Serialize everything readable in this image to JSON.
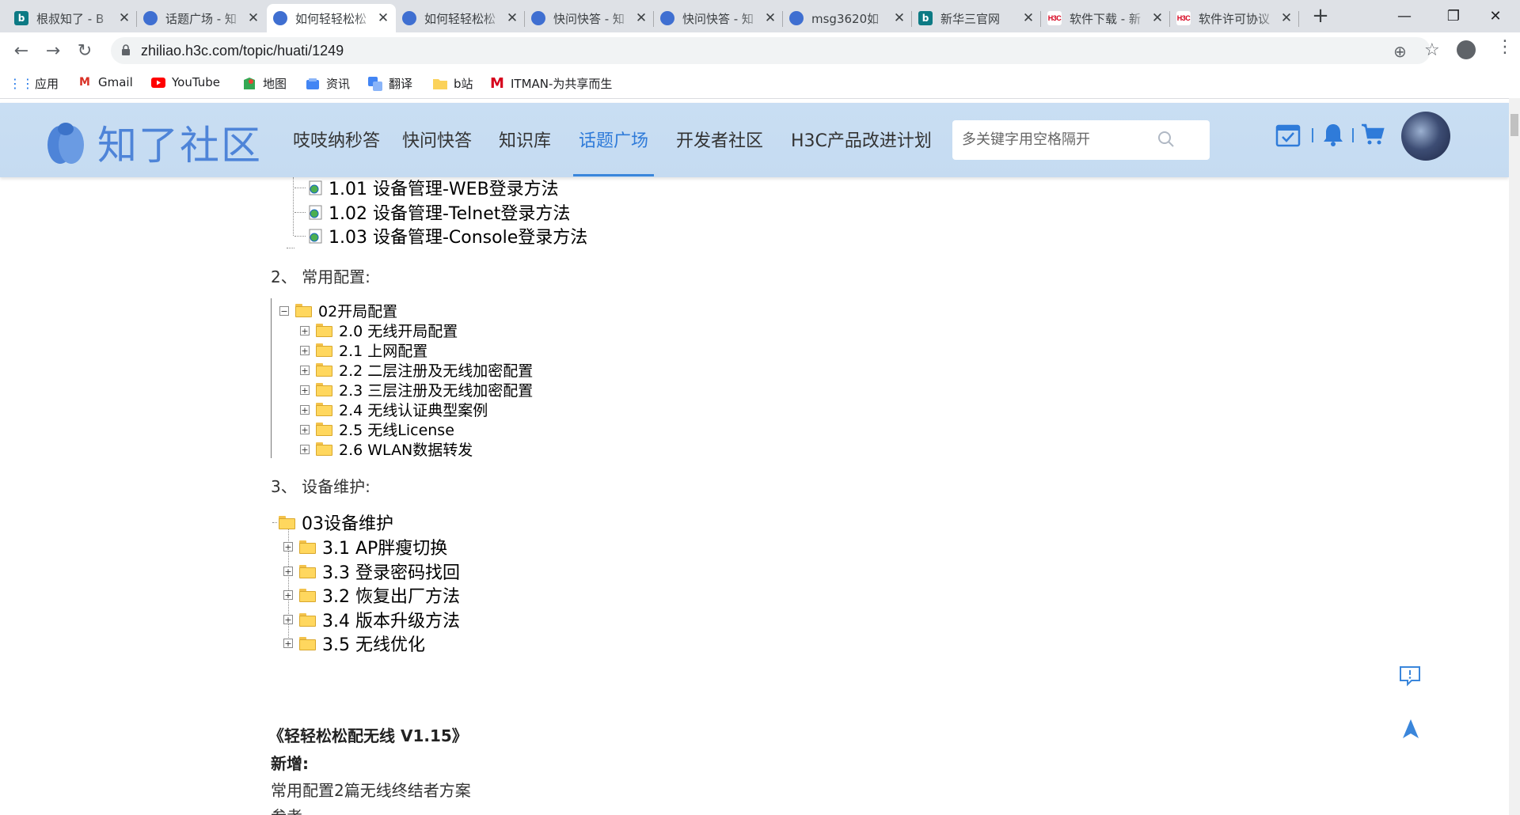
{
  "browser": {
    "tabs": [
      {
        "title": "根叔知了 - B",
        "icon": "bing"
      },
      {
        "title": "话题广场 - 知",
        "icon": "zhiliao"
      },
      {
        "title": "如何轻轻松松",
        "icon": "zhiliao"
      },
      {
        "title": "如何轻轻松松",
        "icon": "zhiliao"
      },
      {
        "title": "快问快答 - 知",
        "icon": "zhiliao"
      },
      {
        "title": "快问快答 - 知",
        "icon": "zhiliao"
      },
      {
        "title": "msg3620如",
        "icon": "zhiliao"
      },
      {
        "title": "新华三官网",
        "icon": "bing"
      },
      {
        "title": "软件下载 - 新",
        "icon": "h3c"
      },
      {
        "title": "软件许可协议",
        "icon": "h3c"
      }
    ],
    "active_tab": 2,
    "url": "zhiliao.h3c.com/topic/huati/1249",
    "h3c_icon_text": "H3C",
    "bing_icon_text": "b",
    "bookmarks": [
      {
        "label": "应用",
        "icon": "apps-grid-icon"
      },
      {
        "label": "Gmail",
        "icon": "gmail-icon"
      },
      {
        "label": "YouTube",
        "icon": "youtube-icon"
      },
      {
        "label": "地图",
        "icon": "maps-icon"
      },
      {
        "label": "资讯",
        "icon": "news-icon"
      },
      {
        "label": "翻译",
        "icon": "translate-icon"
      },
      {
        "label": "b站",
        "icon": "folder-icon"
      },
      {
        "label": "ITMAN-为共享而生",
        "icon": "itman-icon"
      }
    ]
  },
  "site": {
    "logo_text": "知了社区",
    "nav": [
      "吱吱纳秒答",
      "快问快答",
      "知识库",
      "话题广场",
      "开发者社区",
      "H3C产品改进计划"
    ],
    "active_nav": 3,
    "search_placeholder": "多关键字用空格隔开",
    "accent_color": "#3a86db"
  },
  "content": {
    "tree1_items": [
      "1.01 设备管理-WEB登录方法",
      "1.02 设备管理-Telnet登录方法",
      "1.03 设备管理-Console登录方法"
    ],
    "section2_heading": "2、  常用配置:",
    "tree2_root": "02开局配置",
    "tree2_items": [
      "2.0 无线开局配置",
      "2.1 上网配置",
      "2.2 二层注册及无线加密配置",
      "2.3 三层注册及无线加密配置",
      "2.4 无线认证典型案例",
      "2.5 无线License",
      "2.6 WLAN数据转发"
    ],
    "section3_heading": "3、  设备维护:",
    "tree3_root": "03设备维护",
    "tree3_items": [
      "3.1 AP胖瘦切换",
      "3.3 登录密码找回",
      "3.2 恢复出厂方法",
      "3.4 版本升级方法",
      "3.5 无线优化"
    ],
    "book_title": "《轻轻松松配无线 V1.15》",
    "new_label": "新增:",
    "new_item": "常用配置2篇无线终结者方案",
    "cut_text": "参考"
  }
}
